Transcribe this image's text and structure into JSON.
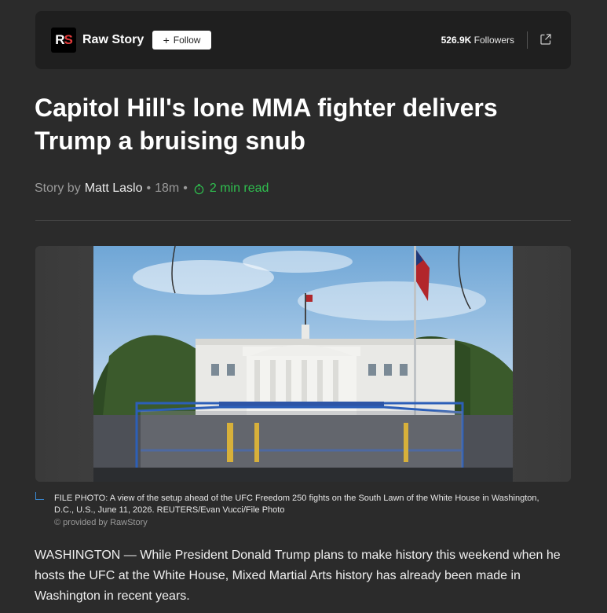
{
  "publisher": {
    "logo_text_r": "R",
    "logo_text_s": "S",
    "name": "Raw Story",
    "follow_label": "Follow",
    "follower_count": "526.9K",
    "followers_label": "Followers"
  },
  "article": {
    "headline": "Capitol Hill's lone MMA fighter delivers Trump a bruising snub",
    "byline_prefix": "Story by",
    "author": "Matt Laslo",
    "age": "18m",
    "separator": "•",
    "read_time": "2 min read"
  },
  "image": {
    "caption": "FILE PHOTO: A view of the setup ahead of the UFC Freedom 250 fights on the South Lawn of the White House in Washington, D.C., U.S., June 11, 2026. REUTERS/Evan Vucci/File Photo",
    "credit": "© provided by RawStory"
  },
  "body": {
    "paragraph_1": "WASHINGTON — While President Donald Trump plans to make history this weekend when he hosts the UFC at the White House, Mixed Martial Arts history has already been made in Washington in recent years."
  },
  "colors": {
    "background": "#2b2b2b",
    "card": "#1f1f1f",
    "accent_green": "#2fbf4f",
    "caption_accent": "#3a8bd6",
    "logo_red": "#e23b3b"
  },
  "icons": [
    "plus-icon",
    "share-icon",
    "timer-icon"
  ]
}
